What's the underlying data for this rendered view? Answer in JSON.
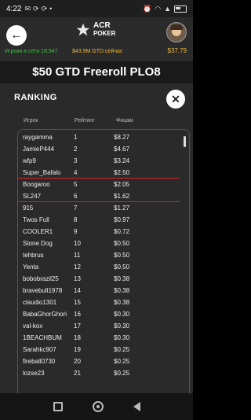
{
  "status_bar": {
    "time": "4:22",
    "icons": [
      "mail-icon",
      "sync-icon",
      "sync-icon",
      "dot-icon"
    ],
    "battery": ""
  },
  "header": {
    "logo_line1": "ACR",
    "logo_line2": "POKER",
    "online_text": "Игроки в сети 18,947",
    "gtd_text": "$43.9M GTD сейчас",
    "balance": "$37.79"
  },
  "tournament": {
    "title": "$50 GTD Freeroll PLO8"
  },
  "ranking": {
    "title": "RANKING",
    "columns": {
      "player": "Игрок",
      "rank": "Рейтинг",
      "chips": "Фишки"
    },
    "rows": [
      {
        "name": "raygamma",
        "rank": "1",
        "chips": "$8.27"
      },
      {
        "name": "JamieP444",
        "rank": "2",
        "chips": "$4.67"
      },
      {
        "name": "wfp9",
        "rank": "3",
        "chips": "$3.24"
      },
      {
        "name": "Super_Bafalo",
        "rank": "4",
        "chips": "$2.50"
      },
      {
        "name": "Boogaroo",
        "rank": "5",
        "chips": "$2.05"
      },
      {
        "name": "SL247",
        "rank": "6",
        "chips": "$1.62"
      },
      {
        "name": "915",
        "rank": "7",
        "chips": "$1.27"
      },
      {
        "name": "Twos Full",
        "rank": "8",
        "chips": "$0.97"
      },
      {
        "name": "COOLER1",
        "rank": "9",
        "chips": "$0.72"
      },
      {
        "name": "Stone Dog",
        "rank": "10",
        "chips": "$0.50"
      },
      {
        "name": "tehbrus",
        "rank": "11",
        "chips": "$0.50"
      },
      {
        "name": "Yenta",
        "rank": "12",
        "chips": "$0.50"
      },
      {
        "name": "bobobrazil25",
        "rank": "13",
        "chips": "$0.38"
      },
      {
        "name": "bravebull1978",
        "rank": "14",
        "chips": "$0.38"
      },
      {
        "name": "claudio1301",
        "rank": "15",
        "chips": "$0.38"
      },
      {
        "name": "BabaGhorGhori",
        "rank": "16",
        "chips": "$0.30"
      },
      {
        "name": "val-kox",
        "rank": "17",
        "chips": "$0.30"
      },
      {
        "name": "1BEACHBUM",
        "rank": "18",
        "chips": "$0.30"
      },
      {
        "name": "Sarahkc907",
        "rank": "19",
        "chips": "$0.25"
      },
      {
        "name": "fireball0730",
        "rank": "20",
        "chips": "$0.25"
      },
      {
        "name": "lozse23",
        "rank": "21",
        "chips": "$0.25"
      }
    ],
    "highlighted_ranks": [
      "4",
      "6"
    ],
    "highlight_color": "#d82020"
  },
  "colors": {
    "online": "#3fbf3f",
    "gold": "#f0b73a"
  }
}
